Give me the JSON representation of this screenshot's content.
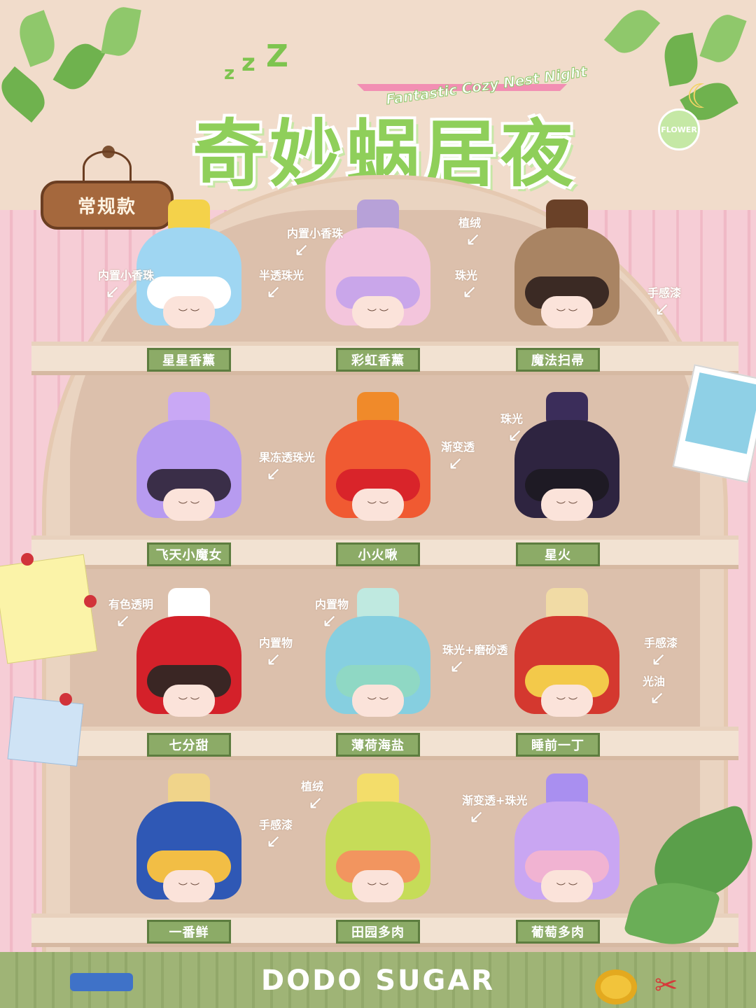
{
  "header": {
    "subtitle": "Fantastic Cozy Nest Night",
    "title": "奇妙蜗居夜",
    "badge": "FLOWER"
  },
  "series_sign": "常规款",
  "brand": "DODO SUGAR",
  "colors": {
    "label_bg": "#8cab67",
    "label_border": "#5d7d3f",
    "wall_pink": "#f6cdd6",
    "cabinet": "#ead4c1",
    "floor": "#9fb476"
  },
  "rows": [
    {
      "items": [
        {
          "name": "星星香薰",
          "body": "#9fd6f2",
          "hair": "#ffffff",
          "topper": "#f4d24a",
          "notes": [
            "内置小香珠",
            "半透珠光"
          ]
        },
        {
          "name": "彩虹香薰",
          "body": "#f3c5dc",
          "hair": "#c9a6ea",
          "topper": "#b7a1d8",
          "notes": [
            "内置小香珠",
            "植绒",
            "珠光"
          ]
        },
        {
          "name": "魔法扫帚",
          "body": "#a98463",
          "hair": "#3b2a24",
          "topper": "#6a4128",
          "notes": [
            "手感漆"
          ]
        }
      ]
    },
    {
      "items": [
        {
          "name": "飞天小魔女",
          "body": "#b79bf0",
          "hair": "#3a2e48",
          "topper": "#c9a8f5",
          "notes": [
            "果冻透珠光"
          ]
        },
        {
          "name": "小火啾",
          "body": "#f05a32",
          "hair": "#d9242a",
          "topper": "#f08a2a",
          "notes": [
            "渐变透"
          ]
        },
        {
          "name": "星火",
          "body": "#2e2440",
          "hair": "#1e1a24",
          "topper": "#3b2d5a",
          "notes": [
            "珠光"
          ]
        }
      ]
    },
    {
      "items": [
        {
          "name": "七分甜",
          "body": "#d4212a",
          "hair": "#3a2624",
          "topper": "#ffffff",
          "notes": [
            "有色透明",
            "内置物"
          ]
        },
        {
          "name": "薄荷海盐",
          "body": "#86cfe0",
          "hair": "#8fd8c4",
          "topper": "#bfe9e0",
          "notes": [
            "内置物",
            "珠光+磨砂透"
          ]
        },
        {
          "name": "睡前一丁",
          "body": "#d4382f",
          "hair": "#f3c94a",
          "topper": "#f1dba5",
          "notes": [
            "手感漆",
            "光油"
          ]
        }
      ]
    },
    {
      "items": [
        {
          "name": "一番鲜",
          "body": "#2f58b5",
          "hair": "#f2be45",
          "topper": "#f0d48a",
          "notes": [
            "手感漆"
          ]
        },
        {
          "name": "田园多肉",
          "body": "#c6dc58",
          "hair": "#f2955f",
          "topper": "#f3dd6a",
          "notes": [
            "植绒"
          ]
        },
        {
          "name": "葡萄多肉",
          "body": "#c9a6f2",
          "hair": "#f1b3d2",
          "topper": "#a98ff0",
          "notes": [
            "渐变透+珠光"
          ]
        }
      ]
    }
  ]
}
